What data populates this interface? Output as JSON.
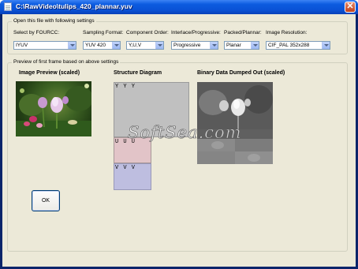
{
  "window": {
    "title": "C:\\RawVideo\\tulips_420_plannar.yuv",
    "close_glyph": "✕"
  },
  "settings_group": {
    "legend": "Open this file with following settings",
    "fields": [
      {
        "label": "Select by FOURCC:",
        "value": "IYUV"
      },
      {
        "label": "Sampling Format:",
        "value": "YUV 420"
      },
      {
        "label": "Component Order:",
        "value": "Y,U,V"
      },
      {
        "label": "Interlace/Progressive:",
        "value": "Progressive"
      },
      {
        "label": "Packed/Plannar:",
        "value": "Planar"
      },
      {
        "label": "Image Resolution:",
        "value": "CIF_PAL 352x288"
      }
    ]
  },
  "preview_group": {
    "legend": "Preview of first frame based on above settings",
    "image_preview_title": "Image Preview (scaled)",
    "structure_title": "Structure Diagram",
    "binary_title": "Binary Data Dumped Out (scaled)",
    "planes": [
      {
        "label": "Y Y Y",
        "color": "#c0c0c0"
      },
      {
        "label": "U U U",
        "color": "#e2c4c8"
      },
      {
        "label": "V V V",
        "color": "#bebee0"
      }
    ]
  },
  "watermark": "SoftSea.com",
  "ok_button": {
    "label": "OK"
  },
  "colors": {
    "title_bar": "#0a52d6",
    "client_bg": "#ece9d8",
    "close_button": "#c1401a"
  }
}
